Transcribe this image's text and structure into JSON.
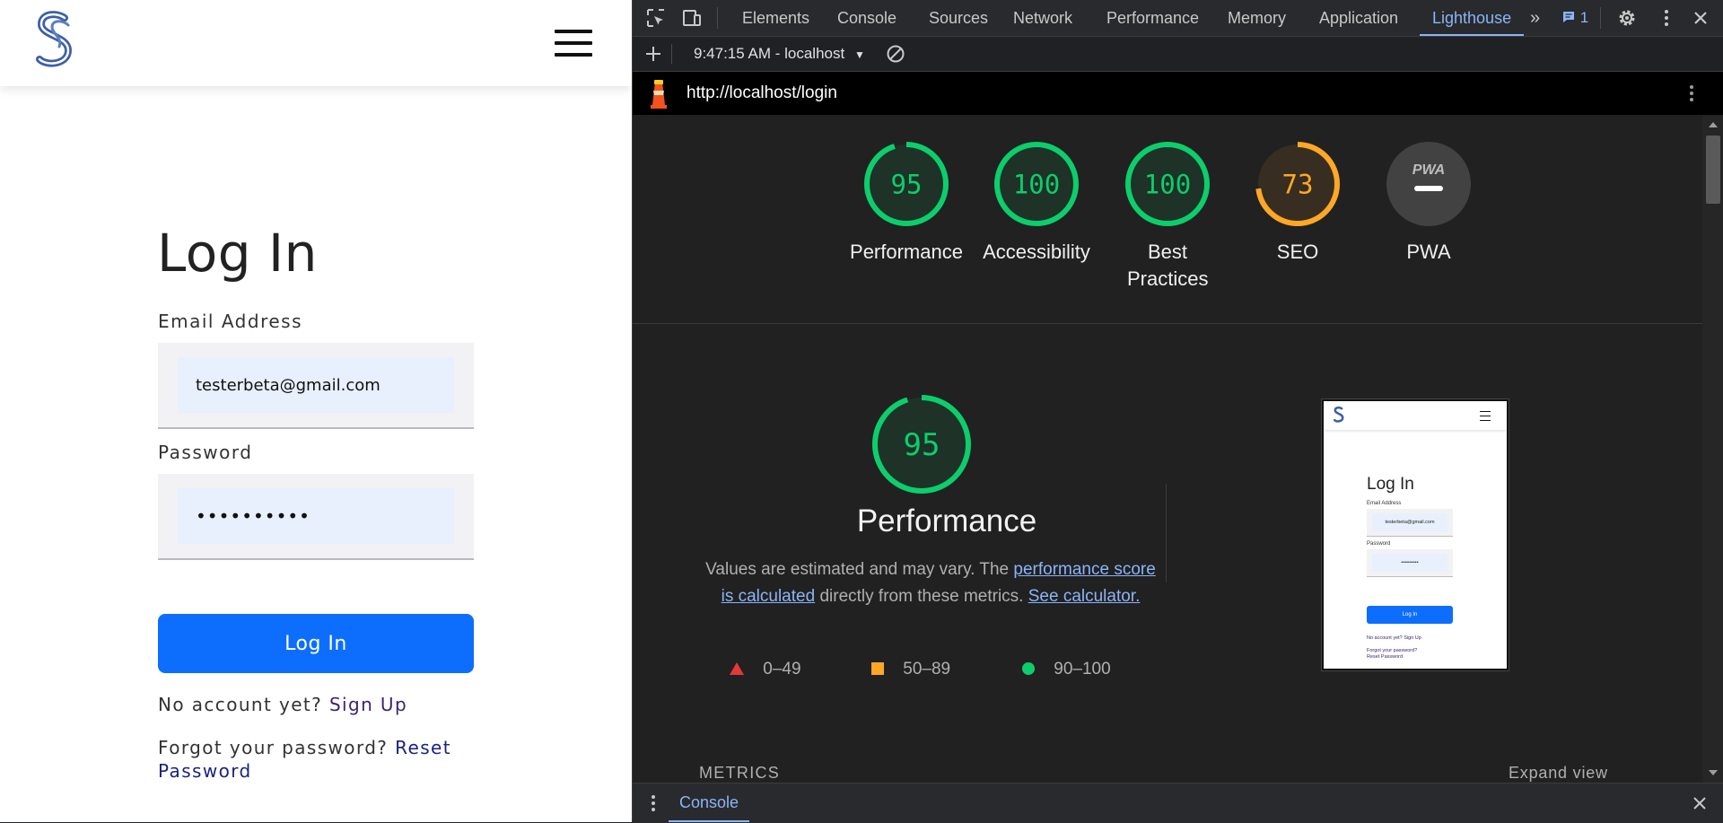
{
  "app": {
    "title": "Log In",
    "email_label": "Email Address",
    "email_value": "testerbeta@gmail.com",
    "password_label": "Password",
    "password_value": "••••••••••",
    "login_button": "Log In",
    "no_account_text": "No account yet?",
    "sign_up_link": "Sign Up",
    "forgot_text": "Forgot your password?",
    "reset_link": "Reset Password"
  },
  "devtools": {
    "tabs": [
      "Elements",
      "Console",
      "Sources",
      "Network",
      "Performance",
      "Memory",
      "Application",
      "Lighthouse"
    ],
    "active_tab": "Lighthouse",
    "issues_count": "1",
    "report_selector": "9:47:15 AM - localhost",
    "url": "http://localhost/login",
    "drawer_tab": "Console"
  },
  "lighthouse": {
    "categories": [
      {
        "label": "Performance",
        "score": "95",
        "level": "pass"
      },
      {
        "label": "Accessibility",
        "score": "100",
        "level": "pass"
      },
      {
        "label": "Best Practices",
        "score": "100",
        "level": "pass"
      },
      {
        "label": "SEO",
        "score": "73",
        "level": "average"
      },
      {
        "label": "PWA",
        "score": "",
        "level": "pwa",
        "badge": "PWA"
      }
    ],
    "performance": {
      "score": "95",
      "title": "Performance",
      "desc_prefix": "Values are estimated and may vary. The",
      "desc_link1": "performance score is calculated",
      "desc_middle": "directly from these metrics.",
      "desc_link2": "See calculator."
    },
    "legend": [
      {
        "range": "0–49",
        "shape": "triangle",
        "color": "#e53935"
      },
      {
        "range": "50–89",
        "shape": "square",
        "color": "#ffa726"
      },
      {
        "range": "90–100",
        "shape": "circle",
        "color": "#0cce6b"
      }
    ],
    "metrics_label": "METRICS",
    "expand_view": "Expand view",
    "screenshot": {
      "title": "Log In",
      "email_label": "Email Address",
      "email_value": "testerbeta@gmail.com",
      "password_label": "Password",
      "password_value": "••••••••••",
      "button": "Log In",
      "no_account": "No account yet? Sign Up",
      "forgot": "Forgot your password?",
      "reset": "Reset Password"
    }
  },
  "colors": {
    "pass": "#0cce6b",
    "average": "#ffa726",
    "fail": "#e53935",
    "accent_blue": "#0d6efd",
    "devtools_link": "#8ab4f8"
  }
}
